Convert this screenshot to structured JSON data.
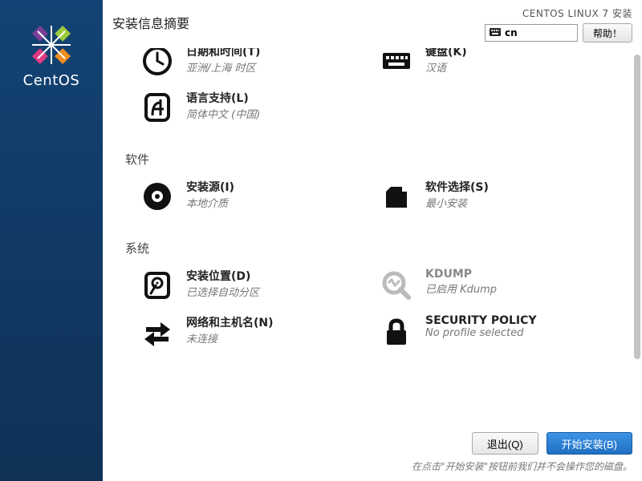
{
  "brand": "CentOS",
  "header": {
    "title": "安装信息摘要",
    "install_label": "CENTOS LINUX 7 安装",
    "keyboard": "cn",
    "help": "帮助！"
  },
  "categories": {
    "localization": {
      "items": [
        {
          "title": "日期和时间(T)",
          "status": "亚洲/上海 时区"
        },
        {
          "title": "键盘(K)",
          "status": "汉语"
        },
        {
          "title": "语言支持(L)",
          "status": "简体中文 (中国)"
        }
      ]
    },
    "software": {
      "label": "软件",
      "items": [
        {
          "title": "安装源(I)",
          "status": "本地介质"
        },
        {
          "title": "软件选择(S)",
          "status": "最小安装"
        }
      ]
    },
    "system": {
      "label": "系统",
      "items": [
        {
          "title": "安装位置(D)",
          "status": "已选择自动分区"
        },
        {
          "title": "KDUMP",
          "status": "已启用 Kdump"
        },
        {
          "title": "网络和主机名(N)",
          "status": "未连接"
        },
        {
          "title": "SECURITY POLICY",
          "status": "No profile selected"
        }
      ]
    }
  },
  "footer": {
    "quit": "退出(Q)",
    "begin": "开始安装(B)",
    "hint": "在点击\"开始安装\"按钮前我们并不会操作您的磁盘。"
  }
}
